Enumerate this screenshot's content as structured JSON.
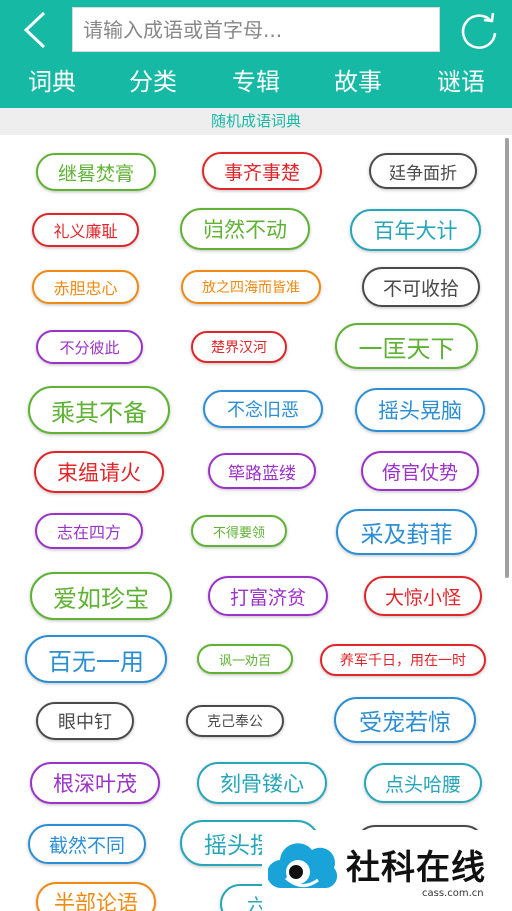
{
  "header": {
    "search_placeholder": "请输入成语或首字母..."
  },
  "tabs": [
    "词典",
    "分类",
    "专辑",
    "故事",
    "谜语"
  ],
  "subtitle": "随机成语词典",
  "colors": {
    "brand": "#16b9a4",
    "green": "#5fb234",
    "red": "#e0262a",
    "gray": "#4a4a4a",
    "teal": "#26a6b8",
    "orange": "#f08a12",
    "purple": "#9b33c8",
    "blue": "#2c8fd4"
  },
  "tags": [
    {
      "text": "继晷焚膏",
      "color": "green"
    },
    {
      "text": "事齐事楚",
      "color": "red"
    },
    {
      "text": "廷争面折",
      "color": "gray"
    },
    {
      "text": "礼义廉耻",
      "color": "red"
    },
    {
      "text": "岿然不动",
      "color": "green"
    },
    {
      "text": "百年大计",
      "color": "teal"
    },
    {
      "text": "赤胆忠心",
      "color": "orange"
    },
    {
      "text": "放之四海而皆准",
      "color": "orange"
    },
    {
      "text": "不可收拾",
      "color": "gray"
    },
    {
      "text": "不分彼此",
      "color": "purple"
    },
    {
      "text": "楚界汉河",
      "color": "red"
    },
    {
      "text": "一匡天下",
      "color": "green"
    },
    {
      "text": "乘其不备",
      "color": "green"
    },
    {
      "text": "不念旧恶",
      "color": "blue"
    },
    {
      "text": "摇头晃脑",
      "color": "blue"
    },
    {
      "text": "束缊请火",
      "color": "red"
    },
    {
      "text": "筚路蓝缕",
      "color": "purple"
    },
    {
      "text": "倚官仗势",
      "color": "purple"
    },
    {
      "text": "志在四方",
      "color": "purple"
    },
    {
      "text": "不得要领",
      "color": "green"
    },
    {
      "text": "采及葑菲",
      "color": "blue"
    },
    {
      "text": "爱如珍宝",
      "color": "green"
    },
    {
      "text": "打富济贫",
      "color": "purple"
    },
    {
      "text": "大惊小怪",
      "color": "red"
    },
    {
      "text": "百无一用",
      "color": "blue"
    },
    {
      "text": "讽一劝百",
      "color": "green"
    },
    {
      "text": "养军千日，用在一时",
      "color": "red"
    },
    {
      "text": "眼中钉",
      "color": "gray"
    },
    {
      "text": "克己奉公",
      "color": "gray"
    },
    {
      "text": "受宠若惊",
      "color": "blue"
    },
    {
      "text": "根深叶茂",
      "color": "purple"
    },
    {
      "text": "刻骨镂心",
      "color": "teal"
    },
    {
      "text": "点头哈腰",
      "color": "teal"
    },
    {
      "text": "截然不同",
      "color": "blue"
    },
    {
      "text": "摇头摆尾",
      "color": "teal"
    },
    {
      "text": "",
      "color": "gray"
    },
    {
      "text": "半部论语",
      "color": "orange"
    },
    {
      "text": "六亲不认",
      "color": "teal"
    }
  ],
  "watermark": {
    "text": "社科在线",
    "sub": "cass.com.cn"
  }
}
